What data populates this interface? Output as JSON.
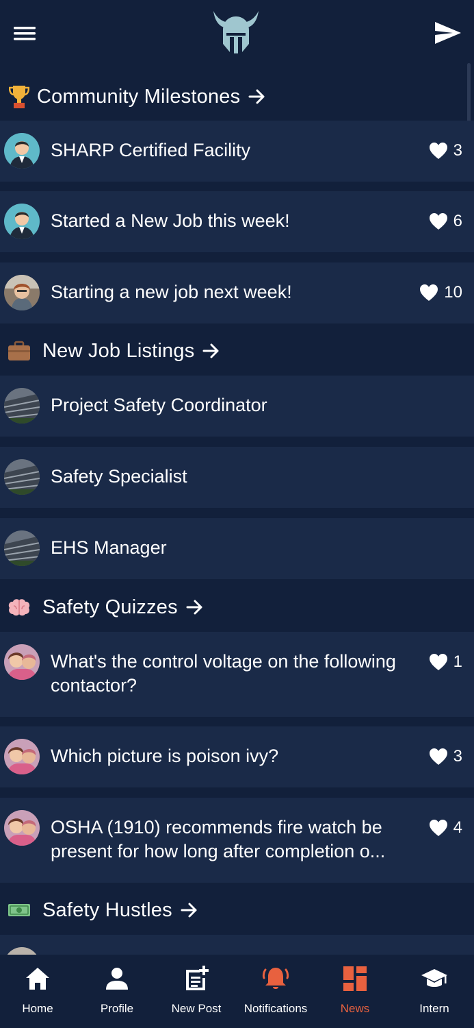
{
  "colors": {
    "background": "#12203b",
    "card": "#1a2a48",
    "accent": "#e8613f",
    "text": "#ffffff"
  },
  "header": {
    "menu_icon": "hamburger-menu-icon",
    "logo": "viking-helmet-logo",
    "send_icon": "send-icon"
  },
  "sections": [
    {
      "title": "Community Milestones",
      "emoji": "trophy",
      "items": [
        {
          "text": "SHARP Certified Facility",
          "likes": "3",
          "avatar": "man-avatar"
        },
        {
          "text": "Started a New Job this week!",
          "likes": "6",
          "avatar": "man-avatar"
        },
        {
          "text": "Starting a new job next week!",
          "likes": "10",
          "avatar": "photo-avatar"
        }
      ]
    },
    {
      "title": "New Job Listings",
      "emoji": "briefcase",
      "items": [
        {
          "text": "Project Safety Coordinator",
          "avatar": "building-avatar"
        },
        {
          "text": "Safety Specialist",
          "avatar": "building-avatar"
        },
        {
          "text": "EHS Manager",
          "avatar": "building-avatar"
        }
      ]
    },
    {
      "title": "Safety Quizzes",
      "emoji": "brain",
      "items": [
        {
          "text": "What's the control voltage on the following contactor?",
          "likes": "1",
          "avatar": "couple-avatar"
        },
        {
          "text": "Which picture is poison ivy?",
          "likes": "3",
          "avatar": "couple-avatar"
        },
        {
          "text": "OSHA (1910) recommends fire watch be present for how long after completion o...",
          "likes": "4",
          "avatar": "couple-avatar"
        }
      ]
    },
    {
      "title": "Safety Hustles",
      "emoji": "dollar-bill",
      "items": []
    }
  ],
  "nav": [
    {
      "label": "Home",
      "icon": "home-icon",
      "active": false
    },
    {
      "label": "Profile",
      "icon": "profile-icon",
      "active": false
    },
    {
      "label": "New Post",
      "icon": "new-post-icon",
      "active": false
    },
    {
      "label": "Notifications",
      "icon": "bell-icon",
      "active": false
    },
    {
      "label": "News",
      "icon": "news-icon",
      "active": true
    },
    {
      "label": "Intern",
      "icon": "graduation-cap-icon",
      "active": false
    }
  ]
}
